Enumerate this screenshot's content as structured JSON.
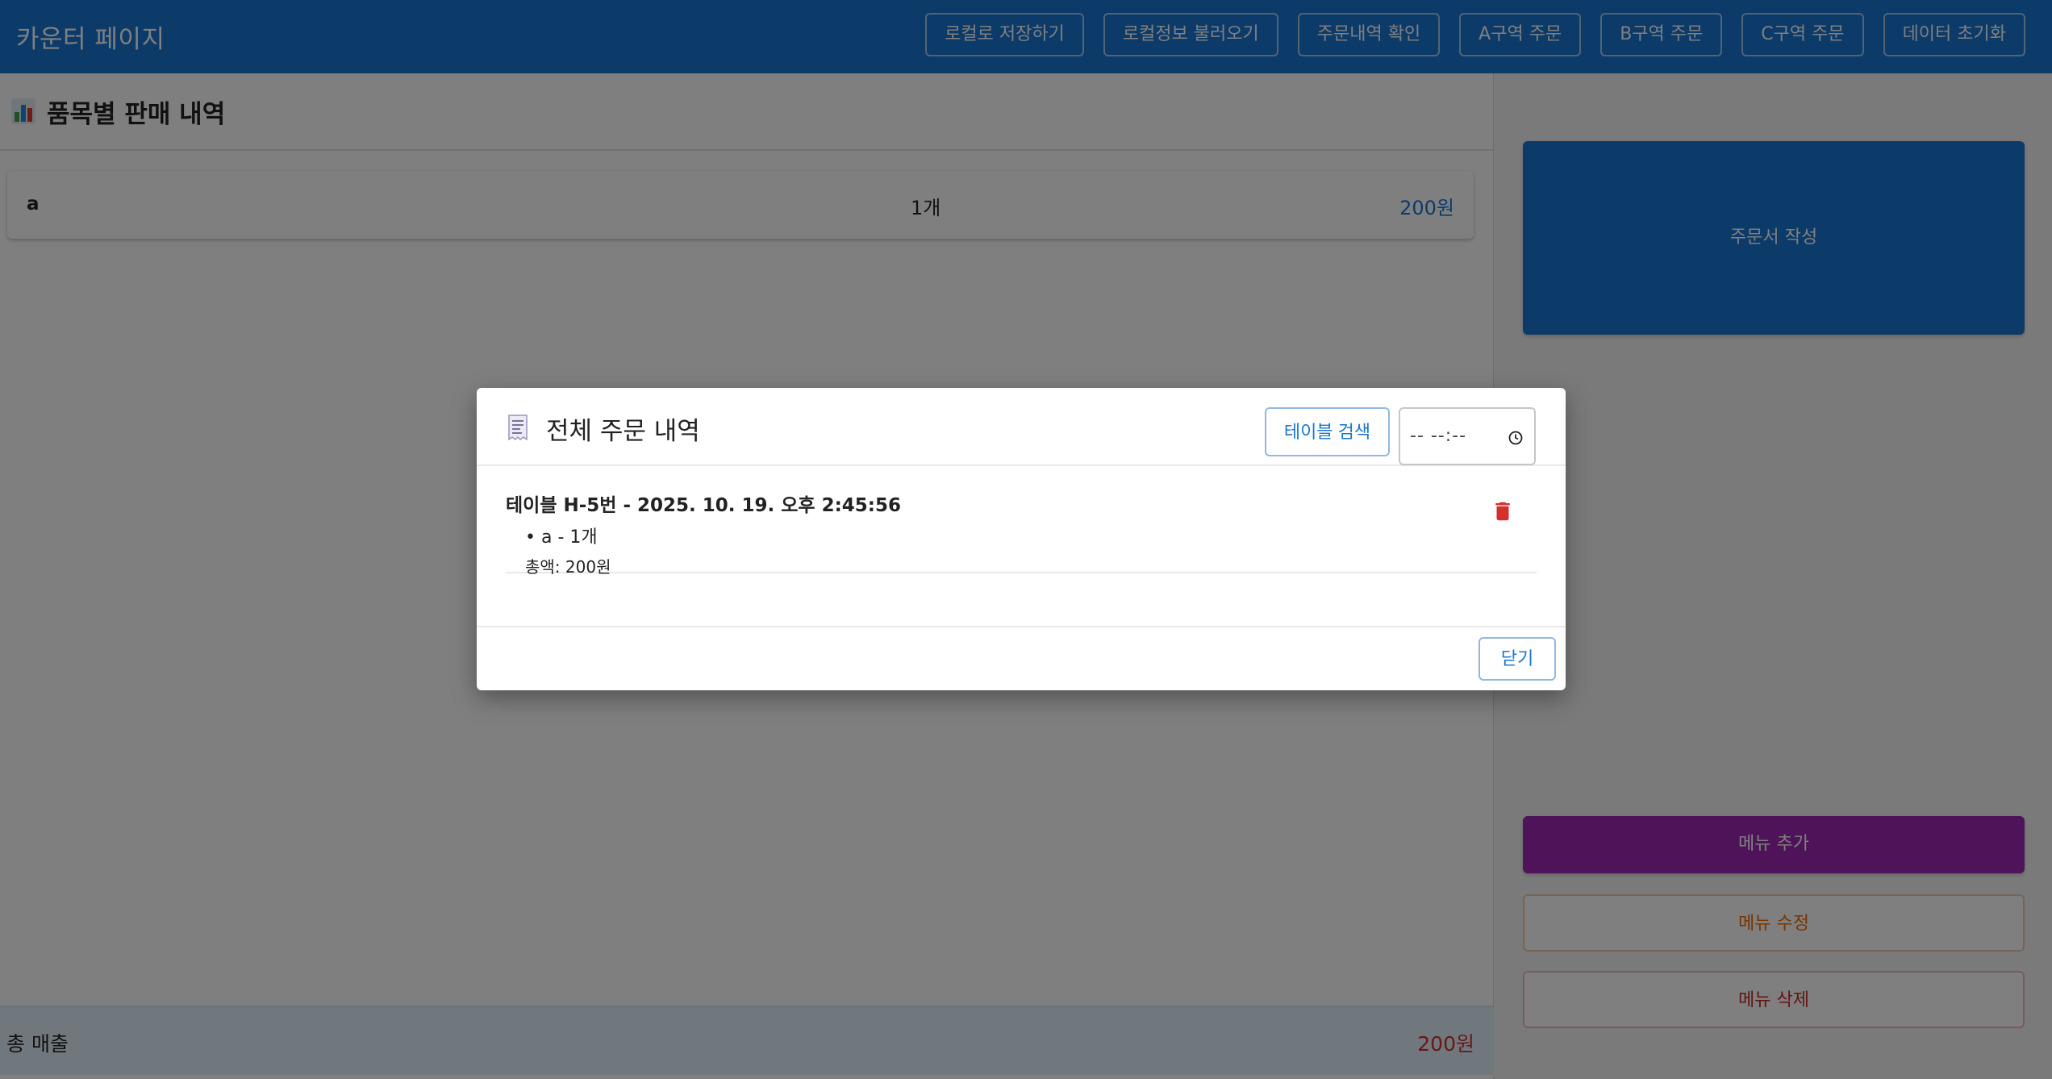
{
  "app": {
    "title": "카운터 페이지",
    "nav": [
      {
        "label": "로컬로 저장하기"
      },
      {
        "label": "로컬정보 불러오기"
      },
      {
        "label": "주문내역 확인"
      },
      {
        "label": "A구역 주문"
      },
      {
        "label": "B구역 주문"
      },
      {
        "label": "C구역 주문"
      },
      {
        "label": "데이터 초기화"
      }
    ]
  },
  "sales": {
    "title": "품목별 판매 내역",
    "icon": "bar-chart-icon",
    "items": [
      {
        "name": "a",
        "qty": "1개",
        "amount": "200원"
      }
    ],
    "total_label": "총 매출",
    "total_value": "200원"
  },
  "side": {
    "order_form": "주문서 작성",
    "add_menu": "메뉴 추가",
    "edit_menu": "메뉴 수정",
    "delete_menu": "메뉴 삭제"
  },
  "dialog": {
    "title": "전체 주문 내역",
    "icon": "receipt-icon",
    "table_search": "테이블 검색",
    "time_value": "-- --:--",
    "orders": [
      {
        "heading": "테이블 H-5번 - 2025. 10. 19. 오후 2:45:56",
        "line": "• a - 1개",
        "total": "총액: 200원"
      }
    ],
    "close": "닫기"
  },
  "colors": {
    "primary": "#1976d2",
    "purple": "#9c27b0",
    "orange": "#ef6c00",
    "red": "#d32f2f"
  }
}
